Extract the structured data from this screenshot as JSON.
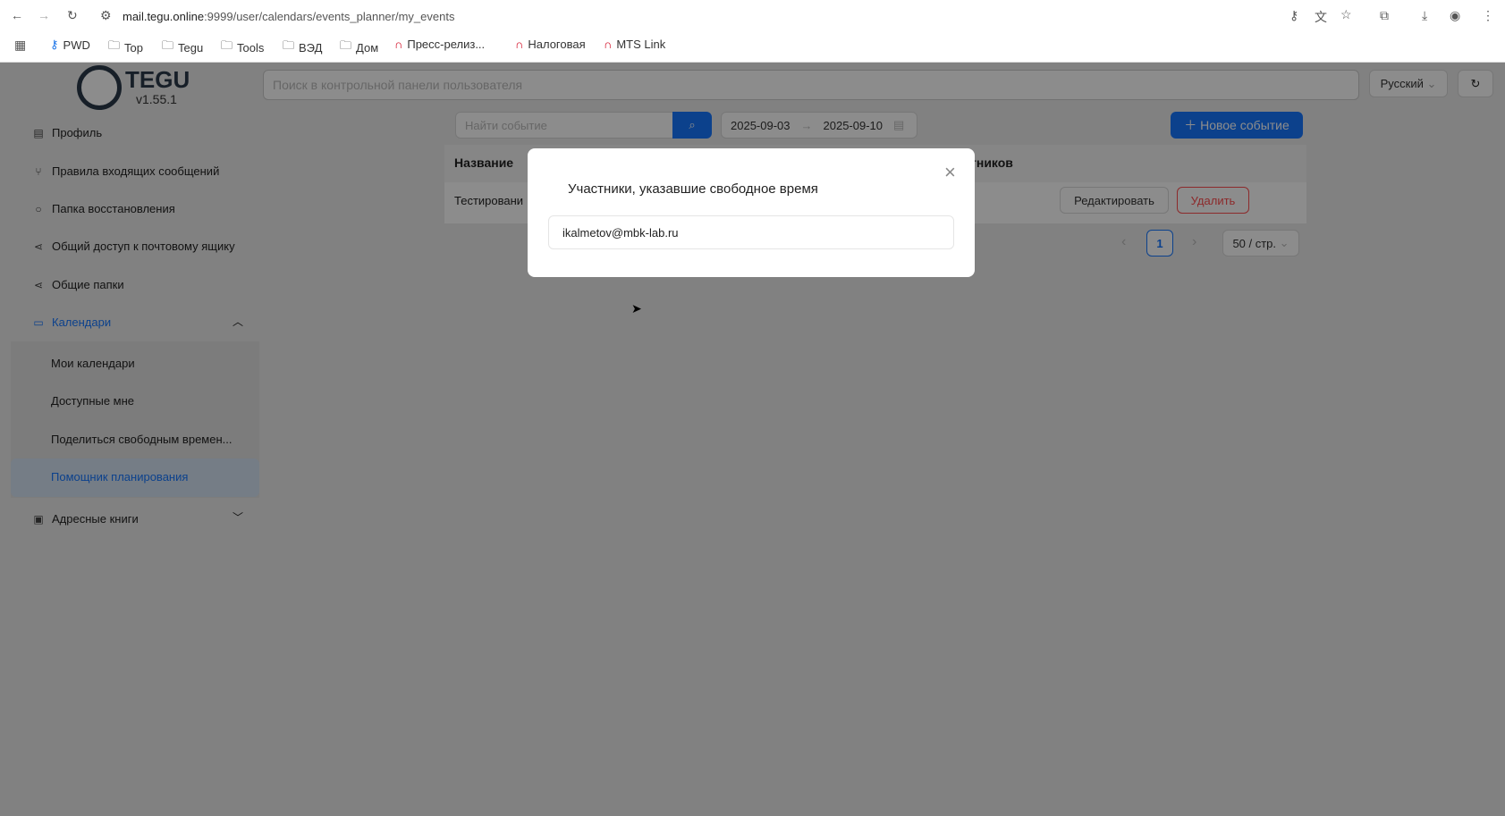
{
  "browser": {
    "url_host": "mail.tegu.online",
    "url_path": ":9999/user/calendars/events_planner/my_events",
    "bookmarks": [
      {
        "label": "PWD",
        "icon": "key-icon"
      },
      {
        "label": "Top",
        "icon": "folder-icon"
      },
      {
        "label": "Tegu",
        "icon": "folder-icon"
      },
      {
        "label": "Tools",
        "icon": "folder-icon"
      },
      {
        "label": "ВЭД",
        "icon": "folder-icon"
      },
      {
        "label": "Дом",
        "icon": "folder-icon"
      },
      {
        "label": "Пресс-релиз...",
        "icon": "mts-icon"
      },
      {
        "label": "Налоговая",
        "icon": "mts-icon"
      },
      {
        "label": "MTS Link",
        "icon": "mts-icon"
      }
    ]
  },
  "app": {
    "logo_text": "TEGU",
    "version": "v1.55.1",
    "search_placeholder": "Поиск в контрольной панели пользователя",
    "language": "Русский"
  },
  "sidebar": {
    "items": [
      "Профиль",
      "Правила входящих сообщений",
      "Папка восстановления",
      "Общий доступ к почтовому ящику",
      "Общие папки",
      "Календари",
      "Адресные книги"
    ],
    "calendar_sub": [
      "Мои календари",
      "Доступные мне",
      "Поделиться свободным времен...",
      "Помощник планирования"
    ]
  },
  "main": {
    "search_placeholder": "Найти событие",
    "date_from": "2025-09-03",
    "date_to": "2025-09-10",
    "new_event": "Новое событие",
    "col_name": "Название",
    "col_participants": "тников",
    "row_name": "Тестировани",
    "edit": "Редактировать",
    "delete": "Удалить",
    "page": "1",
    "page_size": "50 / стр."
  },
  "modal": {
    "title": "Участники, указавшие свободное время",
    "participants": [
      "ikalmetov@mbk-lab.ru"
    ]
  },
  "colors": {
    "primary": "#1677ff",
    "danger": "#ff4d4f"
  }
}
